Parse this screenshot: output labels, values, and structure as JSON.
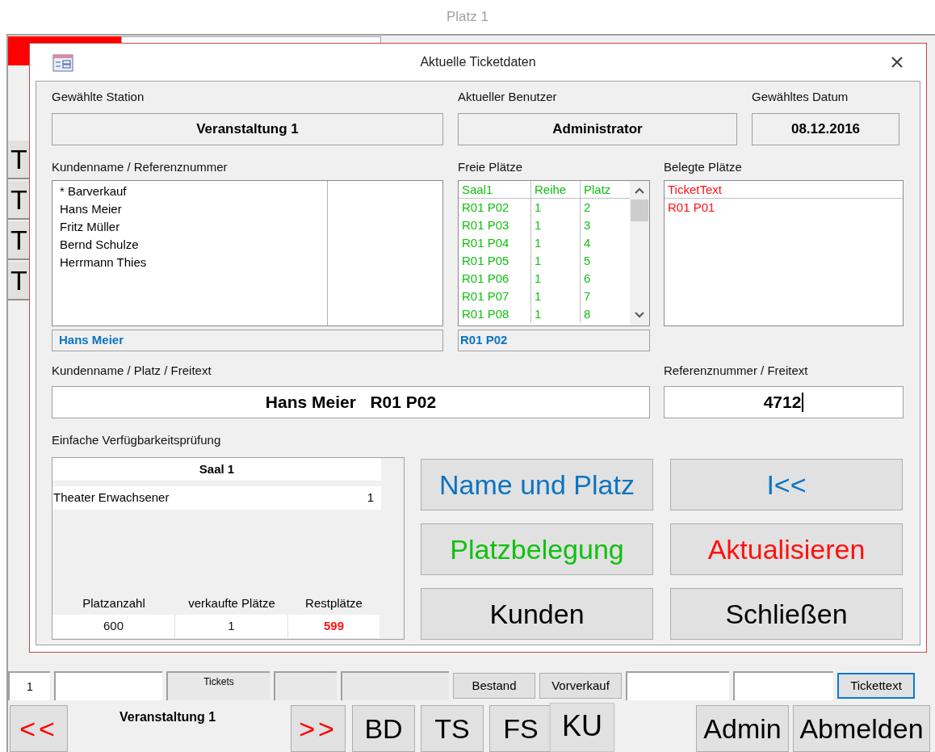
{
  "background_window": {
    "title": "Platz 1",
    "side_buttons": [
      "T",
      "T",
      "T",
      "T"
    ],
    "record_bar": [
      {
        "kind": "field",
        "text": "1"
      },
      {
        "kind": "field"
      },
      {
        "kind": "label",
        "text": "Tickets"
      },
      {
        "kind": "label"
      },
      {
        "kind": "label"
      },
      {
        "kind": "button",
        "text": "Bestand",
        "focused": false
      },
      {
        "kind": "button",
        "text": "Vorverkauf",
        "focused": false
      },
      {
        "kind": "field"
      },
      {
        "kind": "field"
      },
      {
        "kind": "button",
        "text": "Tickettext",
        "focused": true
      }
    ],
    "nav_bar": {
      "prev": "<<",
      "event": "Veranstaltung 1",
      "next": ">>",
      "tabs": [
        {
          "label": "BD",
          "selected": false
        },
        {
          "label": "TS",
          "selected": false
        },
        {
          "label": "FS",
          "selected": false
        },
        {
          "label": "KU",
          "selected": true
        }
      ],
      "buttons": [
        "Admin",
        "Abmelden"
      ]
    }
  },
  "dialog": {
    "title": "Aktuelle Ticketdaten",
    "station": {
      "label": "Gewählte Station",
      "value": "Veranstaltung 1"
    },
    "user": {
      "label": "Aktueller Benutzer",
      "value": "Administrator"
    },
    "date": {
      "label": "Gewähltes Datum",
      "value": "08.12.2016"
    },
    "customers": {
      "label": "Kundenname / Referenznummer",
      "items": [
        "* Barverkauf",
        "Hans Meier",
        "Fritz Müller",
        "Bernd Schulze",
        "Herrmann Thies"
      ],
      "selection": "Hans Meier"
    },
    "free_seats": {
      "label": "Freie Plätze",
      "columns": [
        "Saal1",
        "Reihe",
        "Platz"
      ],
      "rows": [
        [
          "R01 P02",
          "1",
          "2"
        ],
        [
          "R01 P03",
          "1",
          "3"
        ],
        [
          "R01 P04",
          "1",
          "4"
        ],
        [
          "R01 P05",
          "1",
          "5"
        ],
        [
          "R01 P06",
          "1",
          "6"
        ],
        [
          "R01 P07",
          "1",
          "7"
        ],
        [
          "R01 P08",
          "1",
          "8"
        ]
      ],
      "selection": "R01 P02"
    },
    "occupied_seats": {
      "label": "Belegte Plätze",
      "columns": [
        "TicketText"
      ],
      "rows": [
        [
          "R01 P01"
        ]
      ]
    },
    "name_field": {
      "label": "Kundenname / Platz / Freitext",
      "value": "Hans Meier   R01 P02"
    },
    "reference_field": {
      "label": "Referenznummer / Freitext",
      "value": "4712"
    },
    "availability": {
      "label": "Einfache Verfügbarkeitsprüfung",
      "hall": "Saal 1",
      "rows": [
        {
          "name": "Theater Erwachsener",
          "count": "1"
        }
      ],
      "summary": [
        {
          "label": "Platzanzahl",
          "value": "600",
          "alert": false
        },
        {
          "label": "verkaufte Plätze",
          "value": "1",
          "alert": false
        },
        {
          "label": "Restplätze",
          "value": "599",
          "alert": true
        }
      ]
    },
    "buttons": [
      {
        "label": "Name und Platz",
        "color": "#0b74c4"
      },
      {
        "label": "I<<",
        "color": "#0b74c4"
      },
      {
        "label": "Platzbelegung",
        "color": "#10c010"
      },
      {
        "label": "Aktualisieren",
        "color": "#ff1010"
      },
      {
        "label": "Kunden",
        "color": "#000000"
      },
      {
        "label": "Schließen",
        "color": "#000000"
      }
    ]
  }
}
